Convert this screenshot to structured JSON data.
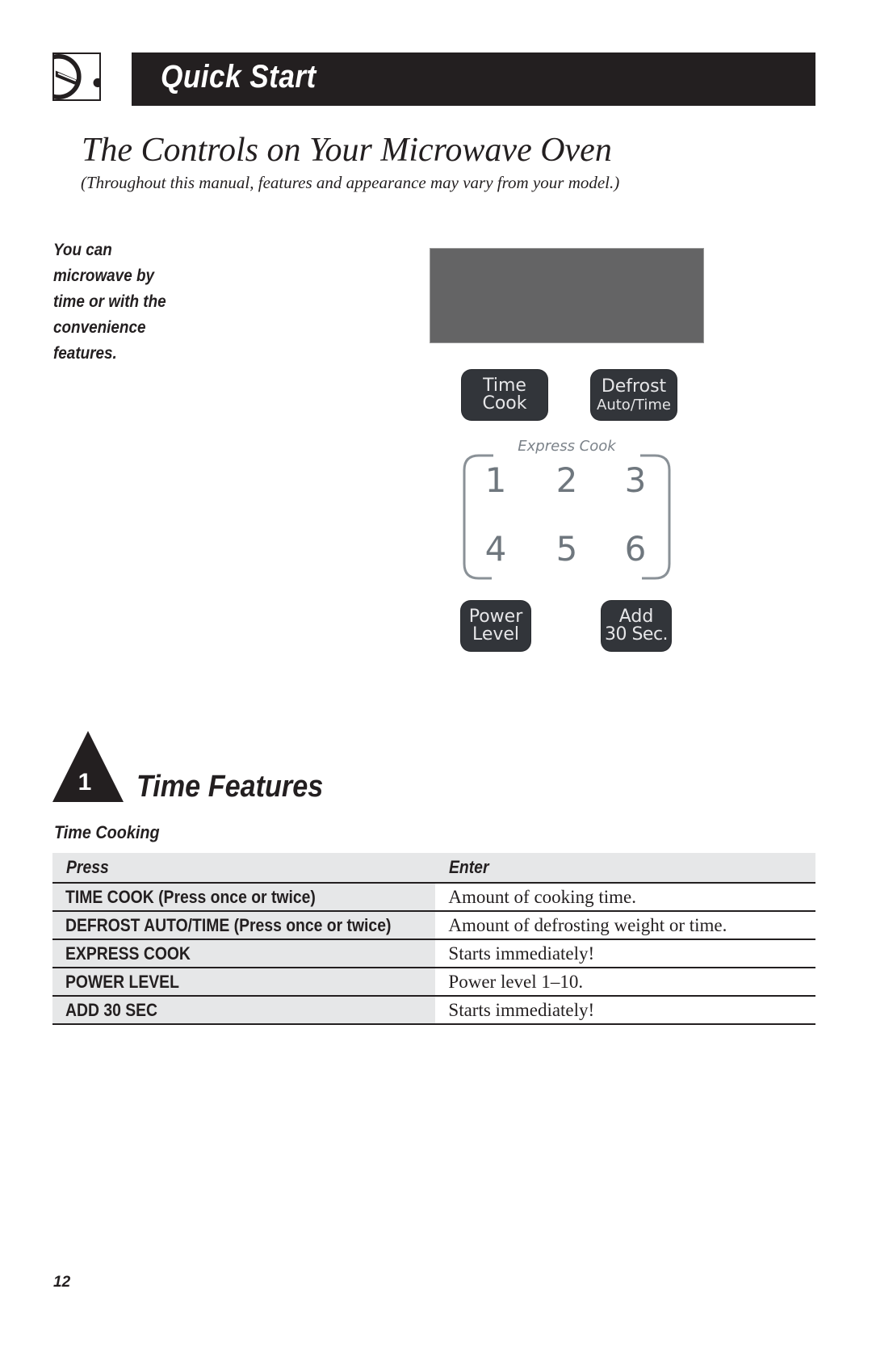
{
  "header": {
    "logo_icon": "microwave-knob-icon",
    "title": "Quick Start"
  },
  "page": {
    "title": "The Controls on Your Microwave Oven",
    "subtitle": "(Throughout this manual, features and appearance may vary from your model.)",
    "intro": "You can microwave by time or with the convenience features.",
    "number": "12"
  },
  "panel": {
    "display_color": "#646465",
    "key_color": "#32353a",
    "time_cook": {
      "line1": "Time",
      "line2": "Cook"
    },
    "defrost": {
      "line1": "Defrost",
      "line2": "Auto/Time"
    },
    "express_cook": {
      "label": "Express Cook",
      "keys": [
        "1",
        "2",
        "3",
        "4",
        "5",
        "6"
      ]
    },
    "power_level": {
      "line1": "Power",
      "line2": "Level"
    },
    "add_30": {
      "line1": "Add",
      "line2": "30 Sec."
    }
  },
  "section": {
    "number": "1",
    "icon": "triangle-step-icon",
    "title": "Time Features",
    "subheading": "Time Cooking"
  },
  "table": {
    "headers": [
      "Press",
      "Enter"
    ],
    "rows": [
      {
        "press": "TIME COOK (Press once or twice)",
        "enter": "Amount of cooking time."
      },
      {
        "press": "DEFROST AUTO/TIME (Press once or twice)",
        "enter": "Amount of defrosting weight or time."
      },
      {
        "press": "EXPRESS COOK",
        "enter": "Starts immediately!"
      },
      {
        "press": "POWER LEVEL",
        "enter": "Power level 1–10."
      },
      {
        "press": "ADD 30 SEC",
        "enter": "Starts immediately!"
      }
    ]
  }
}
